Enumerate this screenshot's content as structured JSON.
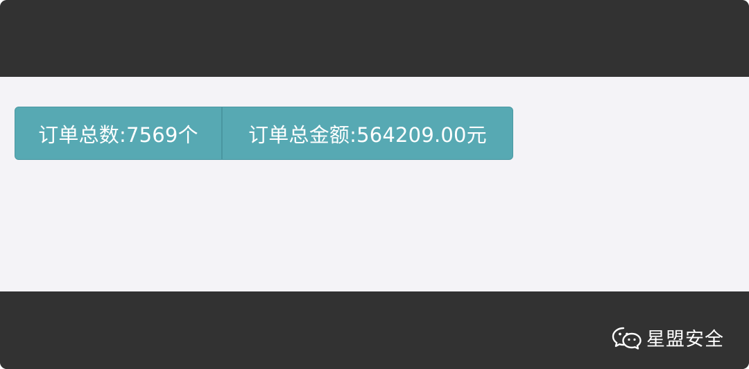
{
  "summary": {
    "order_count_label": "订单总数:7569个",
    "order_total_label": "订单总金额:564209.00元"
  },
  "watermark": {
    "icon": "wechat-icon",
    "text": "星盟安全"
  },
  "colors": {
    "frame_dark": "#323232",
    "content_bg": "#f4f3f7",
    "button_teal": "#57a9b3",
    "button_border": "#4a98a2",
    "text_white": "#ffffff"
  }
}
